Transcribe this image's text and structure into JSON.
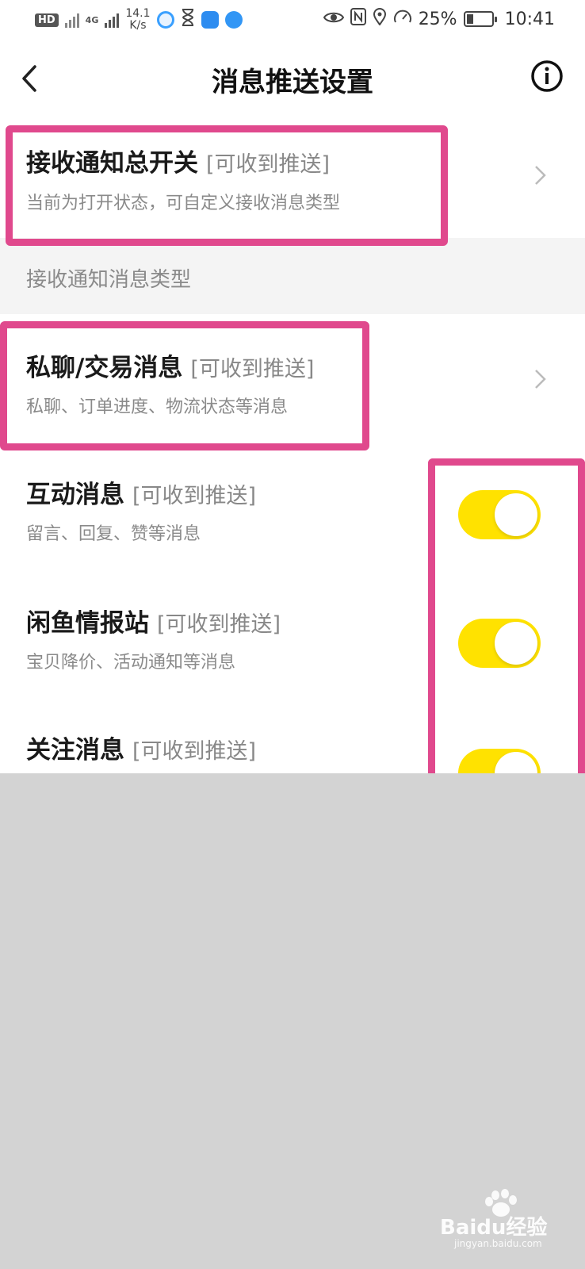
{
  "status_bar": {
    "hd_label": "HD",
    "speed_value": "14.1",
    "speed_unit": "K/s",
    "network_label": "4G",
    "battery_percent": "25%",
    "time": "10:41"
  },
  "header": {
    "title": "消息推送设置"
  },
  "master_switch": {
    "title": "接收通知总开关",
    "tag": "[可收到推送]",
    "subtitle": "当前为打开状态，可自定义接收消息类型"
  },
  "section": {
    "heading": "接收通知消息类型"
  },
  "items": [
    {
      "title": "私聊/交易消息",
      "tag": "[可收到推送]",
      "subtitle": "私聊、订单进度、物流状态等消息",
      "control": "chevron"
    },
    {
      "title": "互动消息",
      "tag": "[可收到推送]",
      "subtitle": "留言、回复、赞等消息",
      "control": "toggle",
      "enabled": true
    },
    {
      "title": "闲鱼情报站",
      "tag": "[可收到推送]",
      "subtitle": "宝贝降价、活动通知等消息",
      "control": "toggle",
      "enabled": true
    },
    {
      "title": "关注消息",
      "tag": "[可收到推送]",
      "subtitle": "",
      "control": "toggle",
      "enabled": true
    }
  ],
  "watermark": {
    "text": "Baidu经验",
    "url_text": "jingyan.baidu.com"
  },
  "colors": {
    "toggle_on": "#ffe200",
    "highlight": "#e0498d",
    "section_bg": "#f4f4f4",
    "backdrop": "#d3d3d3"
  },
  "icons": [
    "back-arrow-icon",
    "info-icon",
    "chevron-right-icon",
    "eye-icon",
    "nfc-icon",
    "location-icon",
    "battery-icon"
  ]
}
